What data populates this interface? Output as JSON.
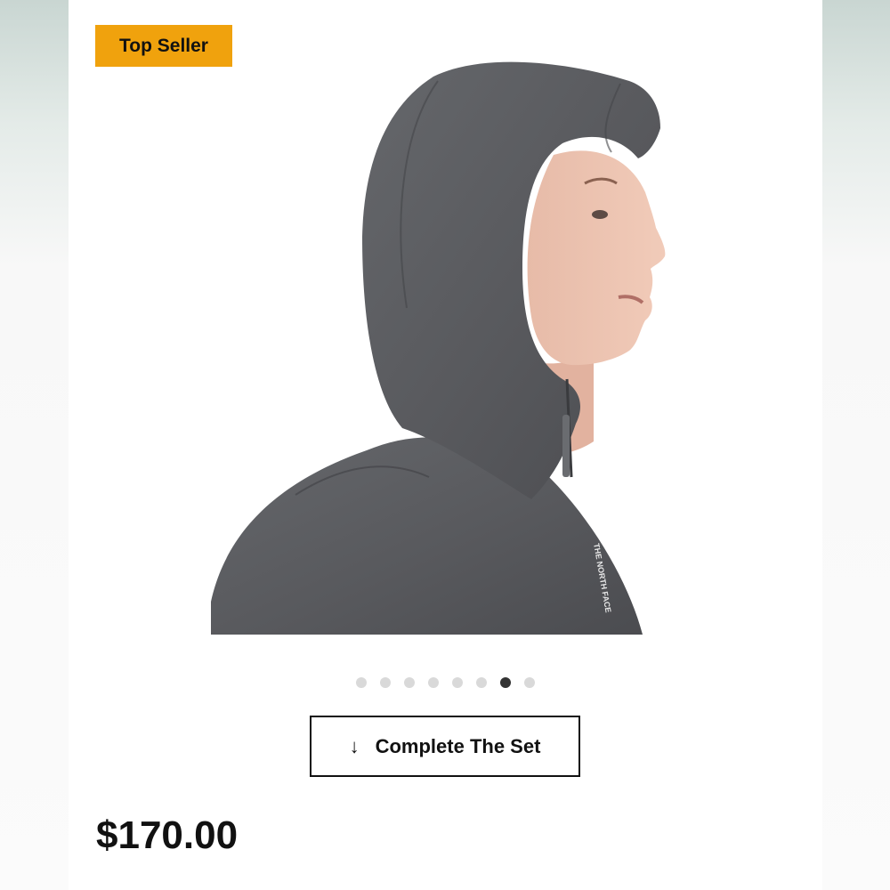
{
  "badge": {
    "label": "Top Seller",
    "color": "#f0a20d"
  },
  "product": {
    "image_alt": "Woman wearing a grey hooded jacket, side profile",
    "jacket_color": "#5a5c60",
    "logo_text": "THE NORTH FACE"
  },
  "carousel": {
    "total": 8,
    "active_index": 6
  },
  "actions": {
    "complete_set_label": "Complete The Set",
    "arrow_icon": "arrow-down-icon"
  },
  "price": {
    "amount": "$170.00"
  }
}
